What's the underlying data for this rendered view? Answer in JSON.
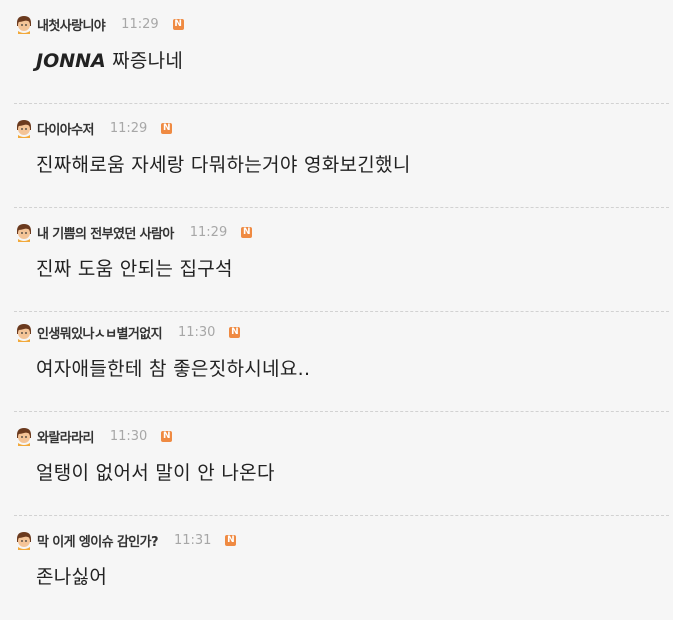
{
  "comments": [
    {
      "nickname": "내첫사랑니야",
      "time": "11:29",
      "badge": "N",
      "emphasis": "JONNA",
      "text": " 짜증나네"
    },
    {
      "nickname": "다이아수저",
      "time": "11:29",
      "badge": "N",
      "text": "진짜해로움 자세랑 다뭐하는거야 영화보긴했니"
    },
    {
      "nickname": "내 기쁨의 전부였던 사람아",
      "time": "11:29",
      "badge": "N",
      "text": "진짜 도움 안되는 집구석"
    },
    {
      "nickname": "인생뭐있나ㅅㅂ별거없지",
      "time": "11:30",
      "badge": "N",
      "text": "여자애들한테 참 좋은짓하시네요.."
    },
    {
      "nickname": "와랄라라리",
      "time": "11:30",
      "badge": "N",
      "text": "얼탱이 없어서 말이 안 나온다"
    },
    {
      "nickname": "막 이게 엥이슈 감인가?",
      "time": "11:31",
      "badge": "N",
      "text": "존나싫어"
    }
  ],
  "colors": {
    "background": "#f6f6f6",
    "badge": "#ef8a42",
    "time": "#a7a7a7",
    "divider": "#d2d2d2"
  },
  "icons": {
    "avatar": "user-avatar-icon",
    "badge": "new-badge-icon"
  }
}
